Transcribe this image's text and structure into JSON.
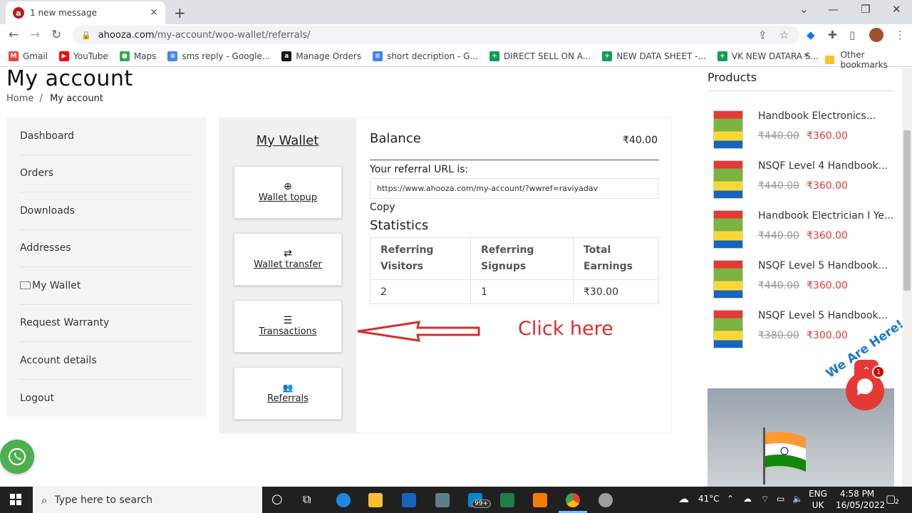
{
  "browser": {
    "tab_title": "1 new message",
    "tab_favicon": "a",
    "url_domain": "ahooza.com",
    "url_path": "/my-account/woo-wallet/referrals/",
    "bookmarks": [
      {
        "label": "Gmail",
        "icon": "gmail-icon",
        "color": "#ea4335",
        "glyph": "M"
      },
      {
        "label": "YouTube",
        "icon": "youtube-icon",
        "color": "#ff0000",
        "glyph": "▶"
      },
      {
        "label": "Maps",
        "icon": "maps-icon",
        "color": "#34a853",
        "glyph": "●"
      },
      {
        "label": "sms reply - Google...",
        "icon": "docs-icon",
        "color": "#4285f4",
        "glyph": "≡"
      },
      {
        "label": "Manage Orders",
        "icon": "amazon-icon",
        "color": "#111111",
        "glyph": "a"
      },
      {
        "label": "short decription - G...",
        "icon": "docs-icon",
        "color": "#4285f4",
        "glyph": "≡"
      },
      {
        "label": "DIRECT SELL ON A...",
        "icon": "sheets-icon",
        "color": "#0f9d58",
        "glyph": "+"
      },
      {
        "label": "NEW DATA SHEET -...",
        "icon": "sheets-icon",
        "color": "#0f9d58",
        "glyph": "+"
      },
      {
        "label": "VK NEW DATARA S...",
        "icon": "sheets-icon",
        "color": "#0f9d58",
        "glyph": "+"
      }
    ],
    "more_bookmarks": "»",
    "other_bookmarks": "Other bookmarks"
  },
  "page": {
    "title": "My account",
    "breadcrumb_home": "Home",
    "breadcrumb_sep": "/",
    "breadcrumb_current": "My account",
    "nav": [
      "Dashboard",
      "Orders",
      "Downloads",
      "Addresses",
      "My Wallet",
      "Request Warranty",
      "Account details",
      "Logout"
    ],
    "wallet_menu": {
      "title": "My Wallet",
      "cards": [
        {
          "label": "Wallet topup",
          "icon": "plus-circle-icon",
          "glyph": "⊕"
        },
        {
          "label": "Wallet transfer",
          "icon": "shuffle-icon",
          "glyph": "⇄"
        },
        {
          "label": "Transactions",
          "icon": "list-icon",
          "glyph": "☰"
        },
        {
          "label": "Referrals",
          "icon": "users-icon",
          "glyph": "👥"
        }
      ]
    },
    "wallet": {
      "balance_label": "Balance",
      "balance_value": "₹40.00",
      "referral_label": "Your referral URL is:",
      "referral_url": "https://www.ahooza.com/my-account/?wwref=raviyadav",
      "copy_label": "Copy",
      "statistics_title": "Statistics",
      "stats_headers": [
        "Referring Visitors",
        "Referring Signups",
        "Total Earnings"
      ],
      "stats_values": [
        "2",
        "1",
        "₹30.00"
      ]
    },
    "annotation": "Click here",
    "annotation_color": "#d32f2f"
  },
  "products": {
    "title": "Products",
    "items": [
      {
        "name": "Handbook Electronics...",
        "old_price": "₹440.00",
        "price": "₹360.00"
      },
      {
        "name": "NSQF Level 4 Handbook...",
        "old_price": "₹440.00",
        "price": "₹360.00"
      },
      {
        "name": "Handbook Electrician I Ye...",
        "old_price": "₹440.00",
        "price": "₹360.00"
      },
      {
        "name": "NSQF Level 5 Handbook...",
        "old_price": "₹440.00",
        "price": "₹360.00"
      },
      {
        "name": "NSQF Level 5 Handbook...",
        "old_price": "₹380.00",
        "price": "₹300.00"
      }
    ],
    "chat_badge": "1",
    "chat_label": "We Are Here!"
  },
  "taskbar": {
    "search_placeholder": "Type here to search",
    "weather": "41°C",
    "lang_1": "ENG",
    "lang_2": "UK",
    "time": "4:58 PM",
    "date": "16/05/2022",
    "notif_count": "2",
    "badge_99": "99+"
  }
}
